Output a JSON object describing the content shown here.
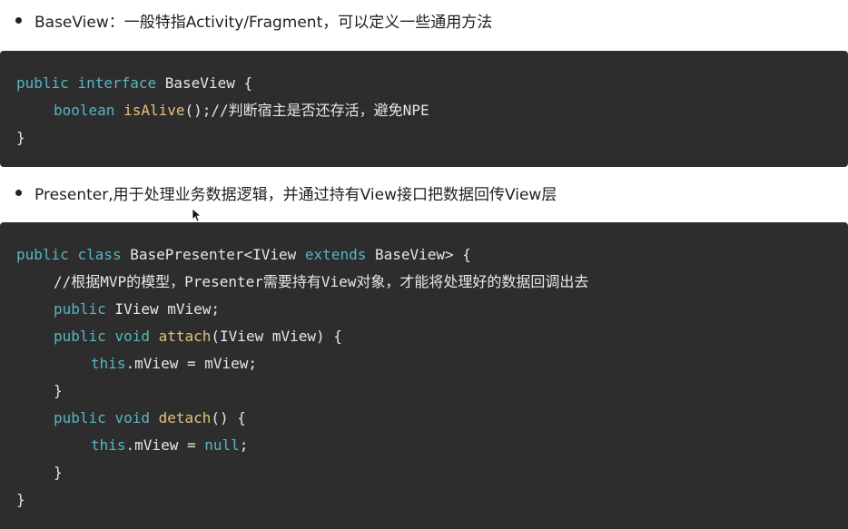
{
  "bullets": [
    {
      "text": "BaseView：一般特指Activity/Fragment，可以定义一些通用方法"
    },
    {
      "text": "Presenter,用于处理业务数据逻辑，并通过持有View接口把数据回传View层"
    }
  ],
  "code1": {
    "line1": {
      "kw1": "public",
      "kw2": "interface",
      "rest": " BaseView {"
    },
    "line2": {
      "kw": "boolean",
      "fn": "isAlive",
      "rest": "();//判断宿主是否还存活，避免NPE"
    },
    "line3": {
      "text": "}"
    }
  },
  "code2": {
    "line1": {
      "kw1": "public",
      "kw2": "class",
      "mid": " BasePresenter<IView ",
      "kw3": "extends",
      "rest": " BaseView> {"
    },
    "line2": {
      "text": "//根据MVP的模型，Presenter需要持有View对象，才能将处理好的数据回调出去"
    },
    "line3": {
      "kw": "public",
      "rest": " IView mView;"
    },
    "line4": {
      "kw1": "public",
      "kw2": "void",
      "fn": "attach",
      "rest": "(IView mView) {"
    },
    "line5": {
      "kw": "this",
      "rest": ".mView = mView;"
    },
    "line6": {
      "text": "}"
    },
    "line7": {
      "kw1": "public",
      "kw2": "void",
      "fn": "detach",
      "rest": "() {"
    },
    "line8": {
      "kw": "this",
      "mid": ".mView = ",
      "kw2": "null",
      "rest": ";"
    },
    "line9": {
      "text": "}"
    },
    "line10": {
      "text": "}"
    }
  },
  "colors": {
    "keyword": "#56b6c2",
    "function": "#e5c07b",
    "code_background": "#2d2d2d"
  },
  "icons": {
    "cursor": "mouse-pointer-icon"
  }
}
